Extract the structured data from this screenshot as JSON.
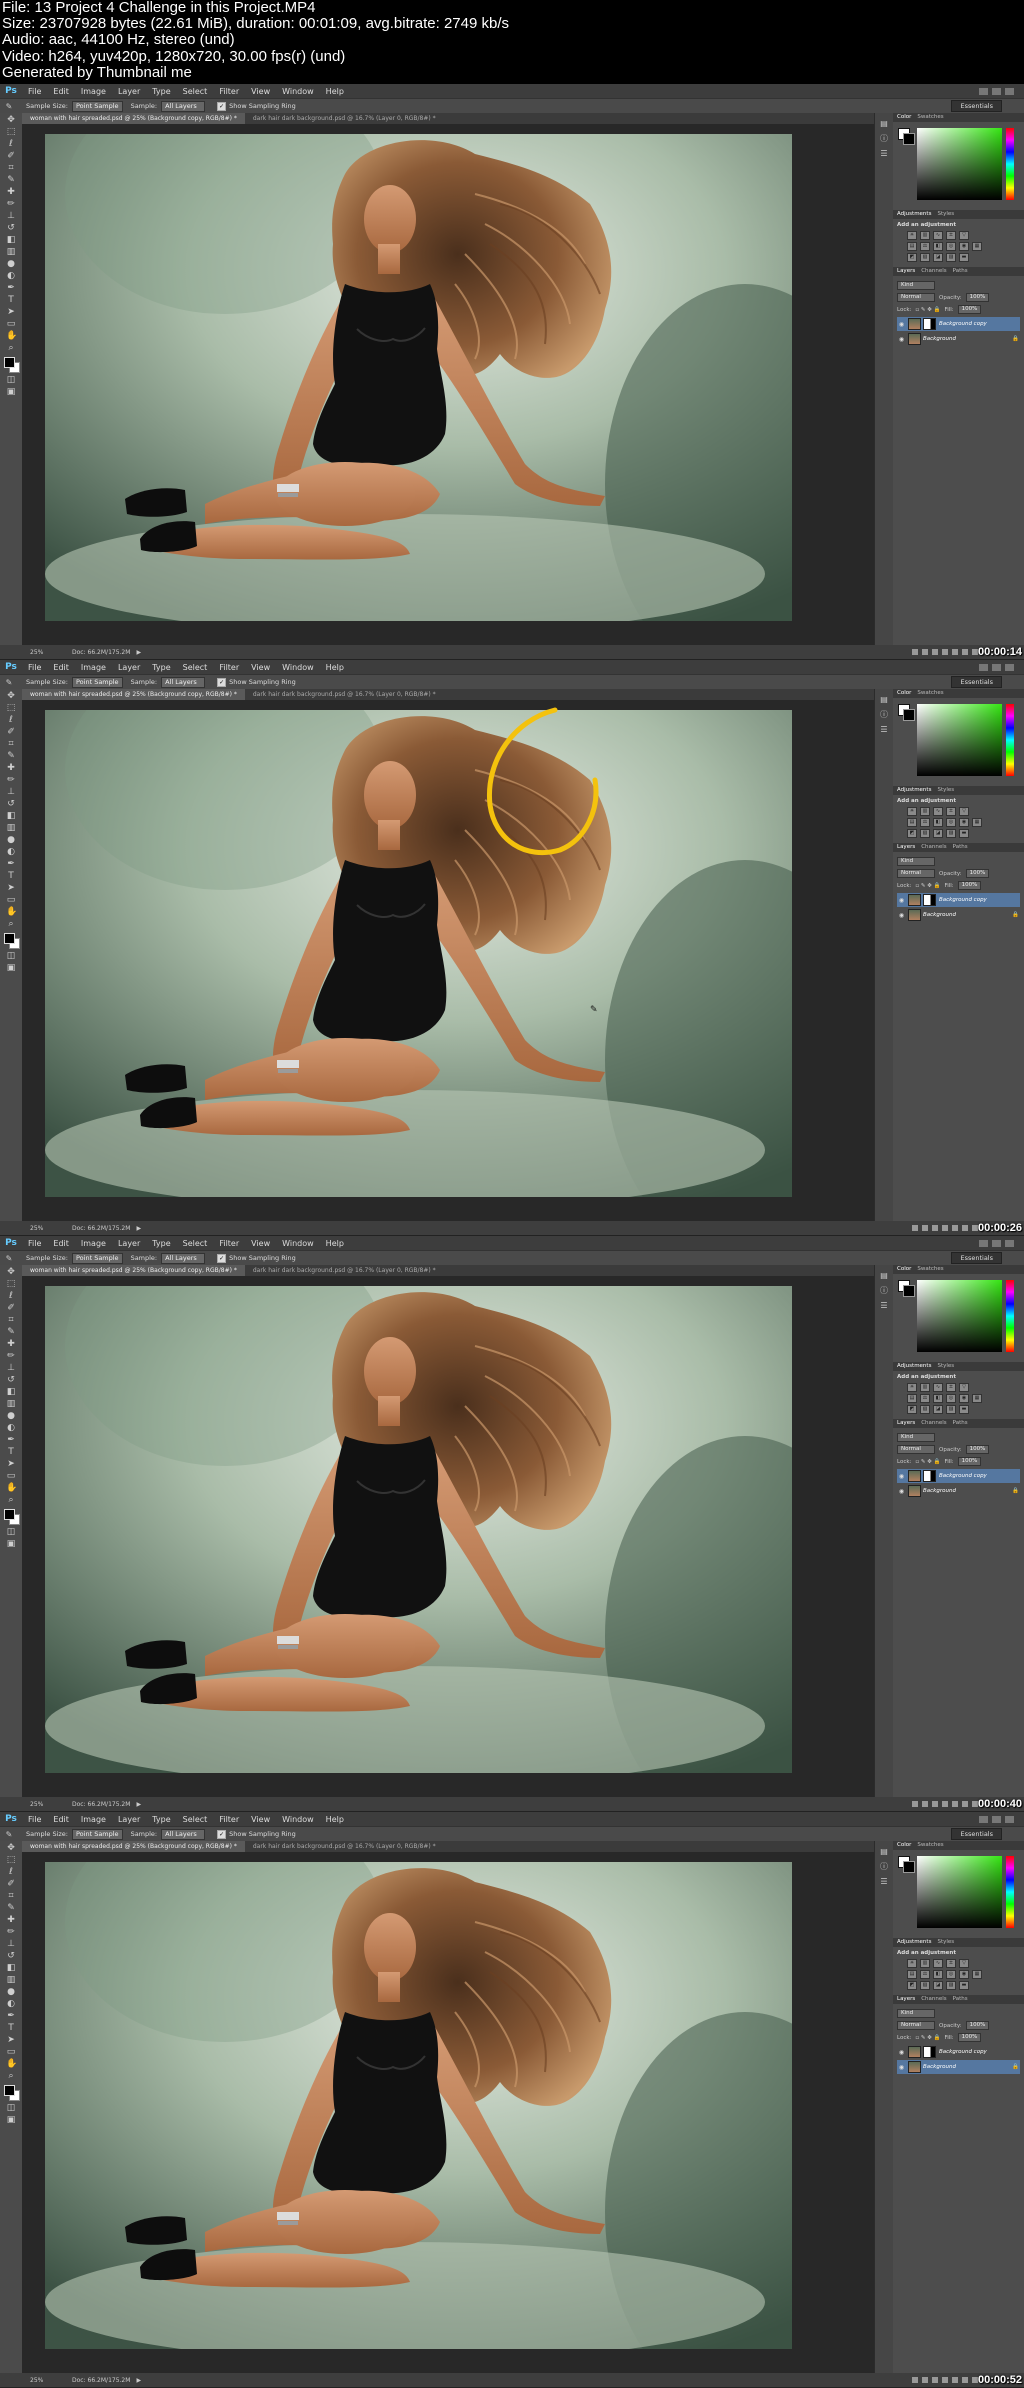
{
  "header": {
    "lines": [
      "File: 13 Project 4 Challenge in this Project.MP4",
      "Size: 23707928 bytes (22.61 MiB), duration: 00:01:09, avg.bitrate: 2749 kb/s",
      "Audio: aac, 44100 Hz, stereo (und)",
      "Video: h264, yuv420p, 1280x720, 30.00 fps(r) (und)",
      "Generated by Thumbnail me"
    ]
  },
  "app": {
    "logo": "Ps",
    "menu": [
      "File",
      "Edit",
      "Image",
      "Layer",
      "Type",
      "Select",
      "Filter",
      "View",
      "Window",
      "Help"
    ],
    "options": {
      "sample_size_label": "Sample Size:",
      "sample_size_value": "Point Sample",
      "sample_label": "Sample:",
      "sample_value": "All Layers",
      "show_ring_label": "Show Sampling Ring",
      "workspace": "Essentials"
    },
    "tabs": [
      "woman with hair spreaded.psd @ 25% (Background copy, RGB/8#) *",
      "dark hair dark background.psd @ 16.7% (Layer 0, RGB/8#) *"
    ],
    "panels": {
      "color_tabs": [
        "Color",
        "Swatches"
      ],
      "adjust_tabs": [
        "Adjustments",
        "Styles"
      ],
      "adjust_heading": "Add an adjustment",
      "layers_tabs": [
        "Layers",
        "Channels",
        "Paths"
      ],
      "kind": "Kind",
      "blend": "Normal",
      "opacity_label": "Opacity:",
      "opacity": "100%",
      "lock_label": "Lock:",
      "fill_label": "Fill:",
      "fill": "100%",
      "layer_top": "Background copy",
      "layer_bottom": "Background"
    },
    "status": {
      "zoom": "25%",
      "doc": "Doc: 66.2M/175.2M"
    }
  },
  "frames": [
    {
      "timestamp": "00:00:14",
      "highlight": false,
      "selected_layer": "top"
    },
    {
      "timestamp": "00:00:26",
      "highlight": true,
      "selected_layer": "top"
    },
    {
      "timestamp": "00:00:40",
      "highlight": false,
      "selected_layer": "top"
    },
    {
      "timestamp": "00:00:52",
      "highlight": false,
      "selected_layer": "bottom"
    }
  ]
}
